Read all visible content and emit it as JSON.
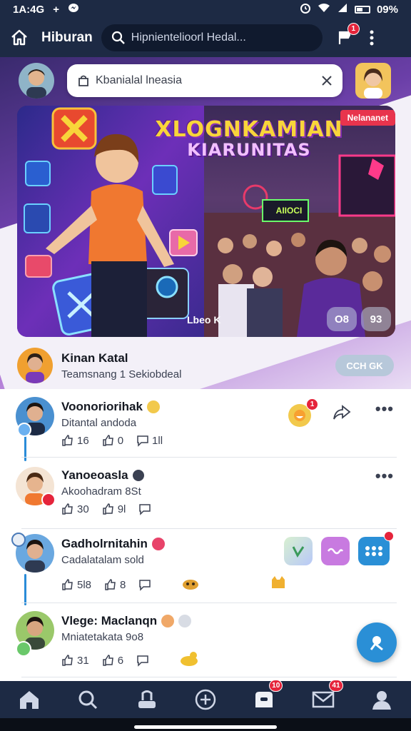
{
  "status_bar": {
    "time": "1A:4G",
    "battery": "09%"
  },
  "header": {
    "title": "Hiburan",
    "search_placeholder": "Hipnientelioorl Hedal...",
    "notification_count": "1"
  },
  "story": {
    "input_text": "Kbanialal lneasia"
  },
  "banner": {
    "title": "XLOGNKAMIAN",
    "subtitle": "KIARUNITAS",
    "tag": "Nelananet",
    "neon_sign": "AIIOCI",
    "caption": "Lbeo K",
    "pill_left": "O8",
    "pill_right": "93"
  },
  "host": {
    "name": "Kinan Katal",
    "subtitle": "Teamsnang 1 Sekiobdeal",
    "follow_label": "CCH GK"
  },
  "posts": [
    {
      "name": "Voonoriorihak",
      "subtitle": "Ditantal andoda",
      "likes": "16",
      "shares": "0",
      "comments": "1ll",
      "notif_badge": "1"
    },
    {
      "name": "Yanoeoasla",
      "subtitle": "Akoohadram 8St",
      "likes": "30",
      "shares": "9l",
      "comments": ""
    },
    {
      "name": "Gadholrnitahin",
      "subtitle": "Cadalatalam sold",
      "likes": "5l8",
      "shares": "8",
      "comments": ""
    },
    {
      "name": "Vlege: Maclanqn",
      "subtitle": "Mniatetakata 9o8",
      "likes": "31",
      "shares": "6",
      "comments": ""
    }
  ],
  "nav_badges": {
    "inbox": "10",
    "messages": "41"
  },
  "colors": {
    "appbar": "#1d2a44",
    "accent": "#2a8fd6",
    "badge": "#e5243b"
  }
}
